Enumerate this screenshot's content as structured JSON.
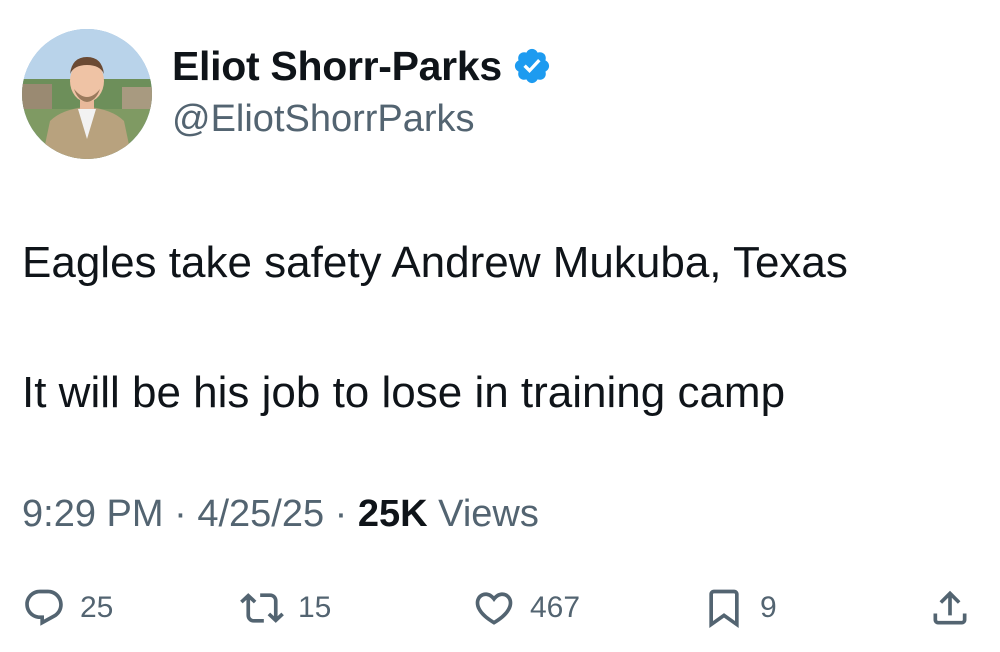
{
  "author": {
    "display_name": "Eliot Shorr-Parks",
    "handle": "@EliotShorrParks",
    "verified": true,
    "avatar_icon": "profile-photo"
  },
  "tweet": {
    "lines": [
      "Eagles take safety Andrew Mukuba, Texas",
      "It will be his job to lose in training camp"
    ]
  },
  "meta": {
    "time": "9:29 PM",
    "separator": "·",
    "date": "4/25/25",
    "views_count": "25K",
    "views_label": "Views"
  },
  "actions": {
    "replies": "25",
    "reposts": "15",
    "likes": "467",
    "bookmarks": "9"
  },
  "colors": {
    "text": "#0f1419",
    "secondary": "#536471",
    "verified": "#1d9bf0"
  }
}
